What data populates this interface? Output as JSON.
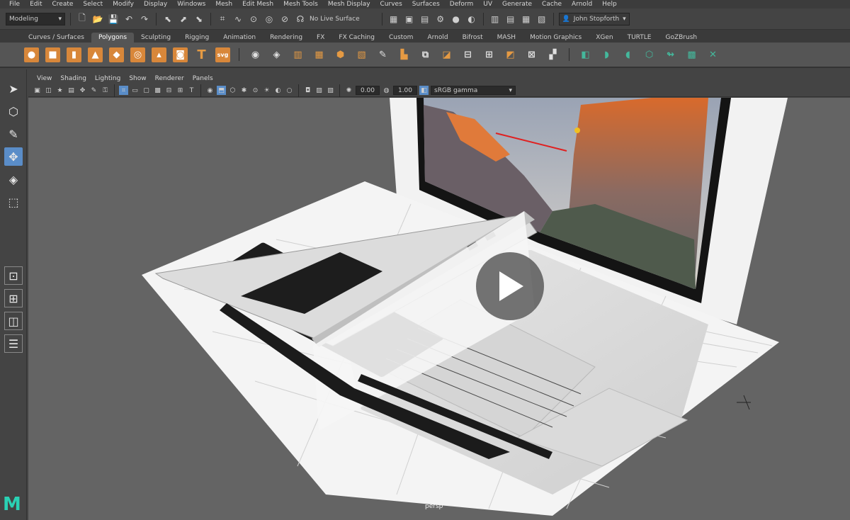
{
  "menubar": [
    "File",
    "Edit",
    "Create",
    "Select",
    "Modify",
    "Display",
    "Windows",
    "Mesh",
    "Edit Mesh",
    "Mesh Tools",
    "Mesh Display",
    "Curves",
    "Surfaces",
    "Deform",
    "UV",
    "Generate",
    "Cache",
    "Arnold",
    "Help"
  ],
  "status": {
    "mode": "Modeling",
    "live_surface": "No Live Surface",
    "user": "John Stopforth"
  },
  "shelf_tabs": [
    "Curves / Surfaces",
    "Polygons",
    "Sculpting",
    "Rigging",
    "Animation",
    "Rendering",
    "FX",
    "FX Caching",
    "Custom",
    "Arnold",
    "Bifrost",
    "MASH",
    "Motion Graphics",
    "XGen",
    "TURTLE",
    "GoZBrush"
  ],
  "active_shelf_tab": "Polygons",
  "panel_menu": [
    "View",
    "Shading",
    "Lighting",
    "Show",
    "Renderer",
    "Panels"
  ],
  "panel_toolbar": {
    "exposure": "0.00",
    "gamma": "1.00",
    "colorspace": "sRGB gamma"
  },
  "viewport": {
    "camera": "persp"
  },
  "colors": {
    "accent_blue": "#5a8dc8",
    "maya_teal": "#2ad1b4",
    "shelf_orange": "#d8873a"
  },
  "logo": "M"
}
